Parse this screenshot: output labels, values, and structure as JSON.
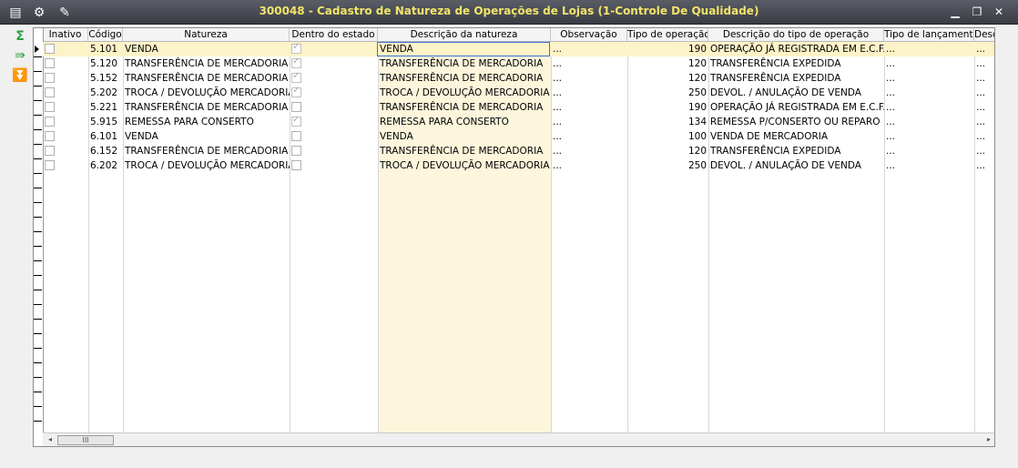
{
  "window": {
    "title": "300048 - Cadastro de Natureza de Operações de Lojas (1-Controle De Qualidade)"
  },
  "icons": {
    "menu": "menu-icon",
    "traffic": "traffic-light-icon",
    "tools": "wrench-icon",
    "sum": "sigma-icon",
    "export": "export-icon",
    "filter": "arrow-down-icon"
  },
  "colors": {
    "title_text": "#f2e46a",
    "row_highlight": "#fdf3c8",
    "column_highlight": "#fdf6dc",
    "leftbar_green": "#2ea043"
  },
  "grid": {
    "columns": [
      "Inativo",
      "Código",
      "Natureza",
      "Dentro do estado",
      "Descrição da natureza",
      "Observação",
      "Tipo de operação",
      "Descrição do tipo de operação",
      "Tipo de lançamento",
      "Desc"
    ],
    "rows": [
      {
        "codigo": "5.101",
        "natureza": "VENDA",
        "dentro": true,
        "descricao": "VENDA",
        "obs": "...",
        "tipo": "190",
        "desc_tipo": "OPERAÇÃO JÁ REGISTRADA EM E.C.F.",
        "lanc": "...",
        "desc2": "..."
      },
      {
        "codigo": "5.120",
        "natureza": "TRANSFERÊNCIA DE MERCADORIA",
        "dentro": true,
        "descricao": "TRANSFERÊNCIA DE MERCADORIA",
        "obs": "...",
        "tipo": "120",
        "desc_tipo": "TRANSFERÊNCIA EXPEDIDA",
        "lanc": "...",
        "desc2": "..."
      },
      {
        "codigo": "5.152",
        "natureza": "TRANSFERÊNCIA DE MERCADORIA",
        "dentro": true,
        "descricao": "TRANSFERÊNCIA DE MERCADORIA",
        "obs": "...",
        "tipo": "120",
        "desc_tipo": "TRANSFERÊNCIA EXPEDIDA",
        "lanc": "...",
        "desc2": "..."
      },
      {
        "codigo": "5.202",
        "natureza": "TROCA / DEVOLUÇÃO MERCADORIA",
        "dentro": true,
        "descricao": "TROCA / DEVOLUÇÃO MERCADORIA",
        "obs": "...",
        "tipo": "250",
        "desc_tipo": "DEVOL. / ANULAÇÃO DE VENDA",
        "lanc": "...",
        "desc2": "..."
      },
      {
        "codigo": "5.221",
        "natureza": "TRANSFERÊNCIA DE MERCADORIA",
        "dentro": false,
        "descricao": "TRANSFERÊNCIA DE MERCADORIA",
        "obs": "...",
        "tipo": "190",
        "desc_tipo": "OPERAÇÃO JÁ REGISTRADA EM E.C.F.",
        "lanc": "...",
        "desc2": "..."
      },
      {
        "codigo": "5.915",
        "natureza": "REMESSA PARA CONSERTO",
        "dentro": true,
        "descricao": "REMESSA PARA CONSERTO",
        "obs": "...",
        "tipo": "134",
        "desc_tipo": "REMESSA P/CONSERTO OU REPARO",
        "lanc": "...",
        "desc2": "..."
      },
      {
        "codigo": "6.101",
        "natureza": "VENDA",
        "dentro": false,
        "descricao": "VENDA",
        "obs": "...",
        "tipo": "100",
        "desc_tipo": "VENDA DE MERCADORIA",
        "lanc": "...",
        "desc2": "..."
      },
      {
        "codigo": "6.152",
        "natureza": "TRANSFERÊNCIA DE MERCADORIA",
        "dentro": false,
        "descricao": "TRANSFERÊNCIA DE MERCADORIA",
        "obs": "...",
        "tipo": "120",
        "desc_tipo": "TRANSFERÊNCIA EXPEDIDA",
        "lanc": "...",
        "desc2": "..."
      },
      {
        "codigo": "6.202",
        "natureza": "TROCA / DEVOLUÇÃO MERCADORIA",
        "dentro": false,
        "descricao": "TROCA / DEVOLUÇÃO MERCADORIA",
        "obs": "...",
        "tipo": "250",
        "desc_tipo": "DEVOL. / ANULAÇÃO DE VENDA",
        "lanc": "...",
        "desc2": "..."
      }
    ]
  },
  "scrollbar": {
    "thumb_glyph": "III"
  }
}
